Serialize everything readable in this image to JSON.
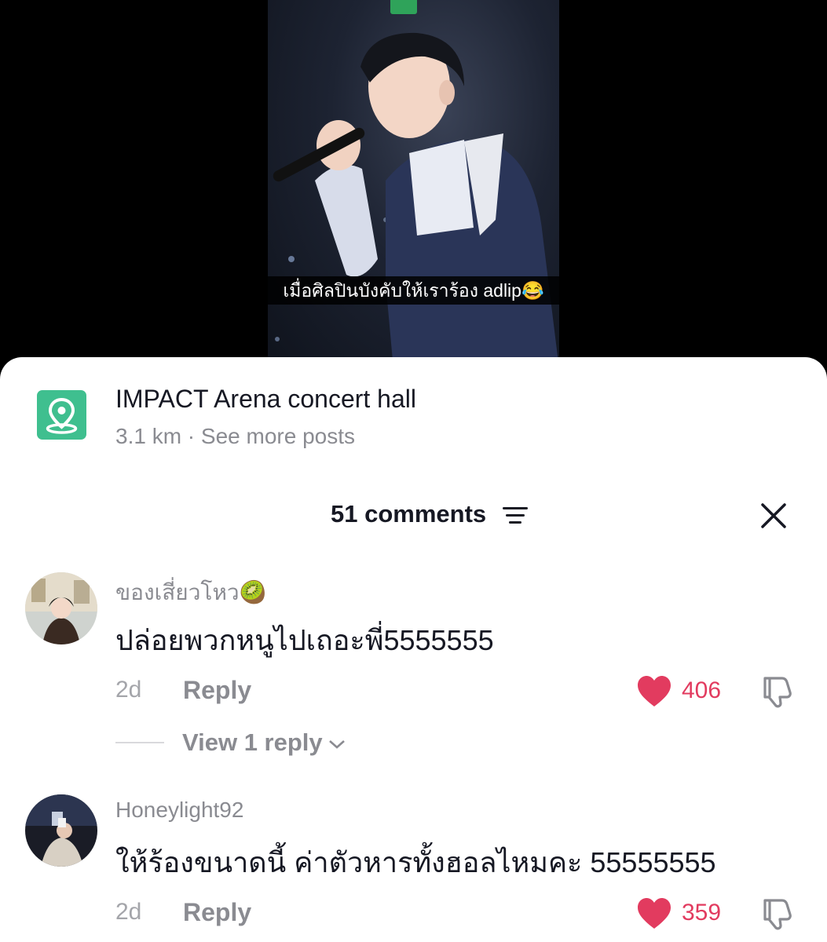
{
  "video": {
    "caption": "เมื่อศิลปินบังคับให้เราร้อง adlip😂"
  },
  "location": {
    "icon": "map-pin-icon",
    "title": "IMPACT Arena concert hall",
    "subtitle": "3.1 km · See more posts"
  },
  "comments_header": {
    "count_label": "51 comments"
  },
  "comments": [
    {
      "username": "ของเสี่ยวโหว🥝",
      "text": "ปล่อยพวกหนูไปเถอะพี่5555555",
      "time": "2d",
      "reply_label": "Reply",
      "likes": "406",
      "view_replies": "View 1 reply"
    },
    {
      "username": "Honeylight92",
      "text": "ให้ร้องขนาดนี้ ค่าตัวหารทั้งฮอลไหมคะ 55555555",
      "time": "2d",
      "reply_label": "Reply",
      "likes": "359"
    }
  ],
  "colors": {
    "accent_heart": "#e23b5f",
    "location_icon_bg": "#3fbf8f"
  }
}
